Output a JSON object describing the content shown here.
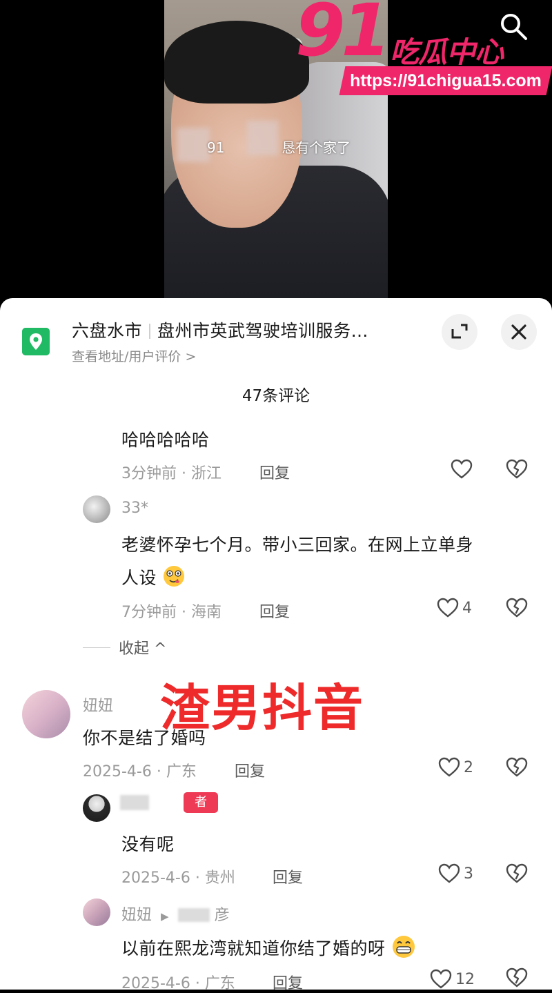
{
  "video": {
    "caption_visible": "91",
    "caption_tail": "恳有个家了"
  },
  "watermark": {
    "logo_number": "91",
    "logo_text": "吃瓜中心",
    "url": "https://91chigua15.com",
    "color": "#f0266a"
  },
  "location": {
    "city": "六盘水市",
    "place": "盘州市英武驾驶培训服务…",
    "subtitle": "查看地址/用户评价 >"
  },
  "comments_count": "47条评论",
  "overlay_title": "渣男抖音",
  "collapse_label": "收起 ^",
  "comments": [
    {
      "text": "哈哈哈哈哈",
      "meta": "3分钟前 · 浙江",
      "reply": "回复",
      "likes": ""
    },
    {
      "name": "33*",
      "text_line1": "老婆怀孕七个月。带小三回家。在网上立单身",
      "text_line2": "人设",
      "meta": "7分钟前 · 海南",
      "reply": "回复",
      "likes": "4"
    },
    {
      "name": "妞妞",
      "text": "你不是结了婚吗",
      "meta": "2025-4-6 · 广东",
      "reply": "回复",
      "likes": "2"
    },
    {
      "badge": "者",
      "text": "没有呢",
      "meta": "2025-4-6 · 贵州",
      "reply": "回复",
      "likes": "3"
    },
    {
      "name": "妞妞",
      "reply_to_tail": "彦",
      "text": "以前在熙龙湾就知道你结了婚的呀",
      "meta": "2025-4-6 · 广东",
      "reply": "回复",
      "likes": "12"
    }
  ],
  "colors": {
    "accent_red": "#ee2a2a",
    "location_green": "#1fba63"
  }
}
